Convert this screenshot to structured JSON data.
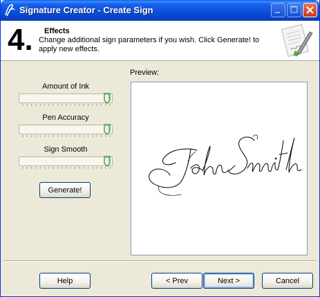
{
  "window": {
    "title": "Signature Creator - Create Sign"
  },
  "header": {
    "step_number": "4.",
    "step_title": "Effects",
    "step_description": "Change additional sign parameters if you wish. Click Generate! to apply new effects."
  },
  "controls": {
    "sliders": [
      {
        "label": "Amount of Ink",
        "value_fraction": 1.0
      },
      {
        "label": "Pen Accuracy",
        "value_fraction": 1.0
      },
      {
        "label": "Sign Smooth",
        "value_fraction": 1.0
      }
    ],
    "generate_label": "Generate!"
  },
  "preview": {
    "label": "Preview:",
    "signature_text": "John Smith"
  },
  "footer": {
    "help_label": "Help",
    "prev_label": "< Prev",
    "next_label": "Next >",
    "cancel_label": "Cancel"
  },
  "colors": {
    "titlebar": "#0A4FD8",
    "window_bg": "#ECE9D8",
    "button_border": "#003C74"
  }
}
